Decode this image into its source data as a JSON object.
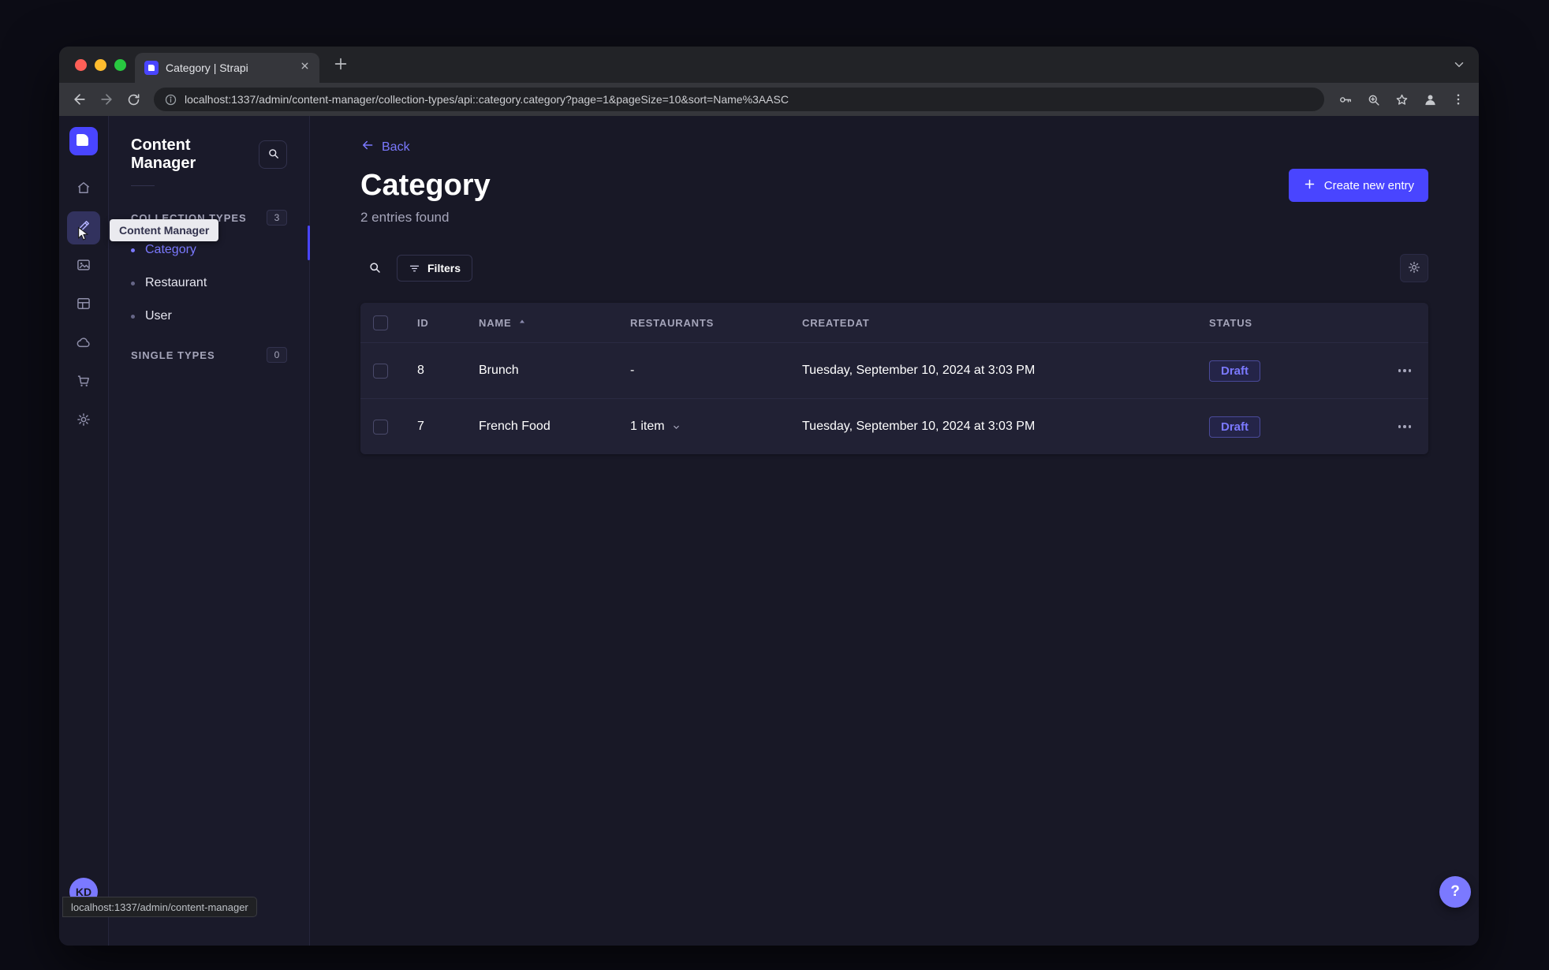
{
  "browser": {
    "tab_title": "Category | Strapi",
    "url": "localhost:1337/admin/content-manager/collection-types/api::category.category?page=1&pageSize=10&sort=Name%3AASC",
    "status_bubble": "localhost:1337/admin/content-manager"
  },
  "rail": {
    "icons": [
      "strapi-logo",
      "home",
      "content-manager",
      "media-library",
      "content-type-builder",
      "cloud",
      "marketplace",
      "settings"
    ],
    "active_icon": "content-manager",
    "avatar_initials": "KD"
  },
  "tooltip": {
    "text": "Content Manager"
  },
  "sidebar": {
    "title": "Content Manager",
    "sections": [
      {
        "label": "COLLECTION TYPES",
        "badge": "3",
        "items": [
          {
            "label": "Category",
            "active": true
          },
          {
            "label": "Restaurant",
            "active": false
          },
          {
            "label": "User",
            "active": false
          }
        ]
      },
      {
        "label": "SINGLE TYPES",
        "badge": "0",
        "items": []
      }
    ]
  },
  "main": {
    "back_label": "Back",
    "title": "Category",
    "subtitle": "2 entries found",
    "create_button": "Create new entry",
    "filters_button": "Filters"
  },
  "table": {
    "headers": {
      "id": "ID",
      "name": "NAME",
      "restaurants": "RESTAURANTS",
      "createdat": "CREATEDAT",
      "status": "STATUS"
    },
    "rows": [
      {
        "id": "8",
        "name": "Brunch",
        "restaurants": "-",
        "created": "Tuesday, September 10, 2024 at 3:03 PM",
        "status": "Draft"
      },
      {
        "id": "7",
        "name": "French Food",
        "restaurants": "1 item",
        "created": "Tuesday, September 10, 2024 at 3:03 PM",
        "status": "Draft"
      }
    ]
  },
  "help_button": "?",
  "colors": {
    "accent": "#4945ff",
    "accent_light": "#7b79ff",
    "page_bg": "#181826",
    "card_bg": "#212134"
  }
}
